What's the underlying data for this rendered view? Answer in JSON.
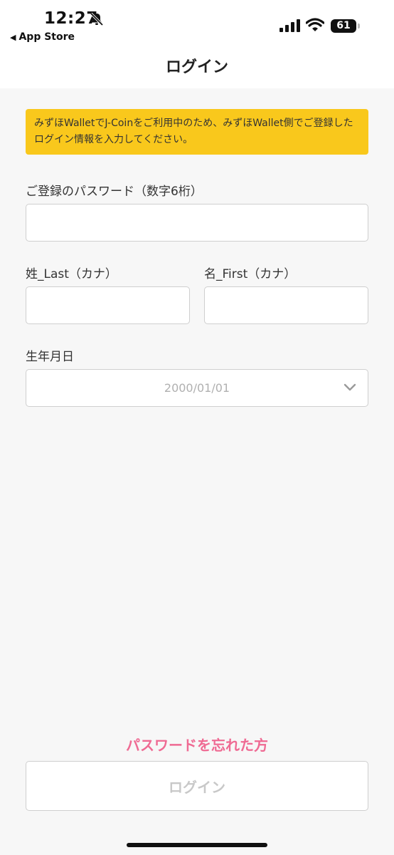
{
  "status_bar": {
    "time": "12:27",
    "back_label": "App Store",
    "battery_level": "61",
    "icons": [
      "bell-slash-icon",
      "signal-icon",
      "wifi-icon",
      "battery-icon"
    ]
  },
  "header": {
    "title": "ログイン"
  },
  "notice": {
    "text": "みずほWalletでJ-Coinをご利用中のため、みずほWallet側でご登録したログイン情報を入力してください。",
    "color": "#f9c81c"
  },
  "form": {
    "password": {
      "label": "ご登録のパスワード（数字6桁）",
      "value": "",
      "placeholder": ""
    },
    "last_name": {
      "label": "姓_Last（カナ）",
      "value": "",
      "placeholder": ""
    },
    "first_name": {
      "label": "名_First（カナ）",
      "value": "",
      "placeholder": ""
    },
    "birthdate": {
      "label": "生年月日",
      "value": "2000/01/01"
    }
  },
  "actions": {
    "forgot_password": "パスワードを忘れた方",
    "login_button": "ログイン",
    "link_color": "#ef6a93"
  }
}
